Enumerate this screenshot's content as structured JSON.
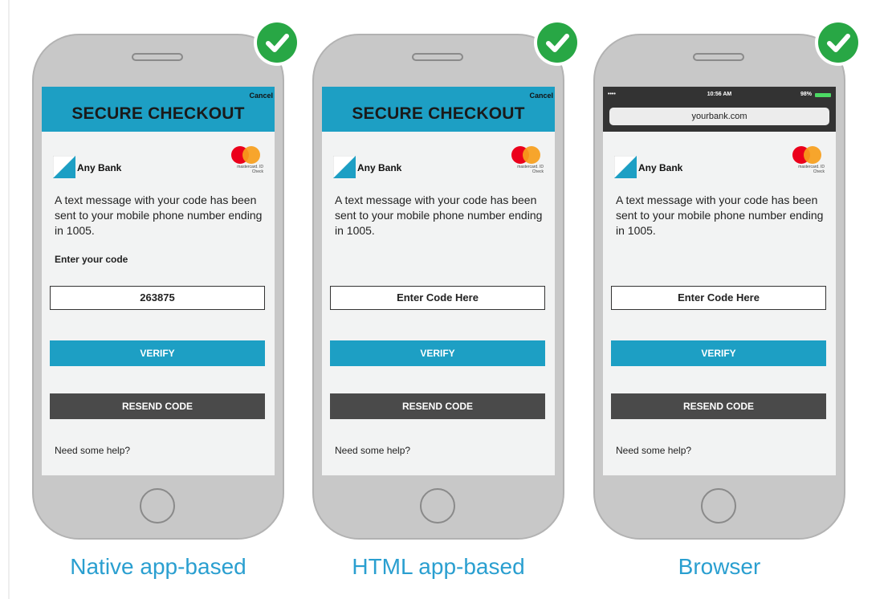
{
  "colors": {
    "header_bg": "#1d9fc4",
    "verify_bg": "#1d9fc4",
    "resend_bg": "#4a4a4a",
    "check_green": "#28a745",
    "caption_blue": "#2a9fd0"
  },
  "phones": [
    {
      "caption": "Native app-based",
      "header_cancel": "Cancel",
      "header_title": "SECURE CHECKOUT",
      "bank_name": "Any Bank",
      "mastercard_text": "mastercard. ID Check",
      "message": "A text message with your code has been sent to your mobile phone number ending in 1005.",
      "enter_label": "Enter your code",
      "code_value": "263875",
      "verify_label": "VERIFY",
      "resend_label": "RESEND CODE",
      "help_text": "Need some help?",
      "check_icon": "check-circle-icon"
    },
    {
      "caption": "HTML app-based",
      "header_cancel": "Cancel",
      "header_title": "SECURE CHECKOUT",
      "bank_name": "Any Bank",
      "mastercard_text": "mastercard. ID Check",
      "message": "A text message with your code has been sent to your mobile phone number ending in 1005.",
      "code_placeholder": "Enter Code Here",
      "verify_label": "VERIFY",
      "resend_label": "RESEND CODE",
      "help_text": "Need some help?",
      "check_icon": "check-circle-icon"
    },
    {
      "caption": "Browser",
      "status_carrier": "••••",
      "status_time": "10:56 AM",
      "status_battery": "98%",
      "url": "yourbank.com",
      "bank_name": "Any Bank",
      "mastercard_text": "mastercard. ID Check",
      "message": "A text message with your code has been sent to your mobile phone number ending in 1005.",
      "code_placeholder": "Enter Code Here",
      "verify_label": "VERIFY",
      "resend_label": "RESEND CODE",
      "help_text": "Need some help?",
      "check_icon": "check-circle-icon"
    }
  ]
}
